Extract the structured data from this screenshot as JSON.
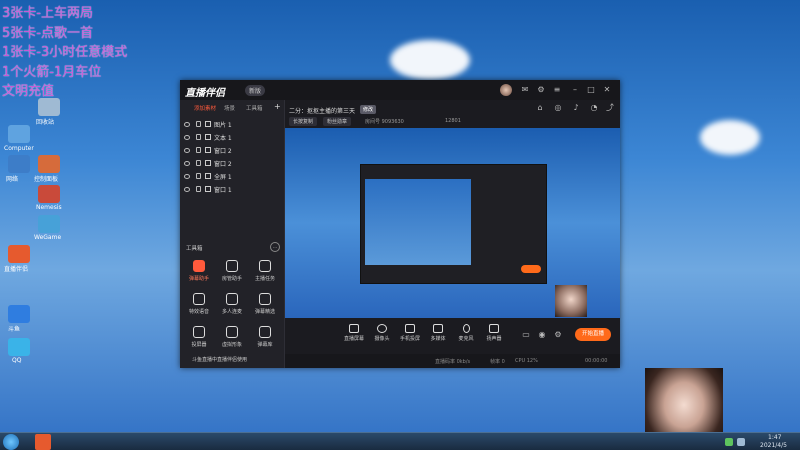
{
  "overlay_text": [
    "3张卡-上车两局",
    "5张卡-点歌一首",
    "1张卡-3小时任意模式",
    "1个火箭-1月车位",
    "文明充值"
  ],
  "desktop_icons": [
    {
      "label": "Computer",
      "color": "#5fa3e0"
    },
    {
      "label": "回收站",
      "color": "#9fbad3"
    },
    {
      "label": "网络",
      "color": "#3d7dc8"
    },
    {
      "label": "控制面板",
      "color": "#d66b3b"
    },
    {
      "label": "Nemesis",
      "color": "#c94a3a"
    },
    {
      "label": "WeGame",
      "color": "#47a1d8"
    },
    {
      "label": "直播伴侣",
      "color": "#e65a2e"
    },
    {
      "label": "斗鱼",
      "color": "#2f7de0"
    },
    {
      "label": "QQ",
      "color": "#3ab3e8"
    }
  ],
  "app": {
    "logo": "直播伴侣",
    "version": "新版",
    "left_tabs": [
      "添加素材",
      "场景",
      "工具箱"
    ],
    "sources": [
      "图片 1",
      "文本 1",
      "窗口 2",
      "窗口 2",
      "全屏 1",
      "窗口 1"
    ],
    "tools_title": "工具箱",
    "tools": [
      {
        "label": "弹幕助手",
        "active": true
      },
      {
        "label": "房管助手",
        "active": false
      },
      {
        "label": "主播任务",
        "active": false
      },
      {
        "label": "特效语音",
        "active": false
      },
      {
        "label": "多人连麦",
        "active": false
      },
      {
        "label": "弹幕精选",
        "active": false
      },
      {
        "label": "投屏器",
        "active": false
      },
      {
        "label": "虚拟形象",
        "active": false
      },
      {
        "label": "弹幕库",
        "active": false
      }
    ],
    "bottom_link": "斗鱼直播中直播伴侣使用",
    "stream_title": "二分：抠抠主播的第三天",
    "stream_badge": "修改",
    "chips": [
      "长按复制",
      "粉丝勋章"
    ],
    "meta": [
      "房间号 9093630",
      "12801"
    ],
    "controls": [
      "直播屏幕",
      "摄像头",
      "手机投屏",
      "多媒体",
      "麦克风",
      "扬声器"
    ],
    "go_live": "开始直播",
    "status": [
      "直播码率 0kb/s",
      "帧率 0",
      "CPU 12%",
      "00:00:00"
    ]
  },
  "taskbar": {
    "time": "1:47",
    "date": "2021/4/5"
  },
  "colors": {
    "accent": "#ff5a3c",
    "go_live": "#ff6a1a",
    "overlay_text": "#c65ad6"
  }
}
